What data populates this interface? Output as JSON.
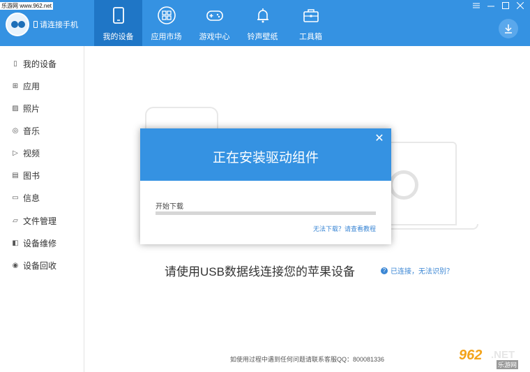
{
  "watermark": "乐游网 www.962.net",
  "header": {
    "connect_label": "请连接手机",
    "nav": [
      {
        "label": "我的设备",
        "icon": "tablet-icon",
        "active": true
      },
      {
        "label": "应用市场",
        "icon": "apps-grid-icon",
        "active": false
      },
      {
        "label": "游戏中心",
        "icon": "gamepad-icon",
        "active": false
      },
      {
        "label": "铃声壁纸",
        "icon": "bell-icon",
        "active": false
      },
      {
        "label": "工具箱",
        "icon": "toolbox-icon",
        "active": false
      }
    ],
    "window_controls": [
      "menu-icon",
      "minimize-icon",
      "maximize-icon",
      "close-icon"
    ],
    "download_icon": "download-icon",
    "accent": "#3592e2"
  },
  "sidebar": {
    "items": [
      {
        "label": "我的设备",
        "icon": "device-icon"
      },
      {
        "label": "应用",
        "icon": "apps-icon"
      },
      {
        "label": "照片",
        "icon": "photo-icon"
      },
      {
        "label": "音乐",
        "icon": "music-icon"
      },
      {
        "label": "视频",
        "icon": "video-icon"
      },
      {
        "label": "图书",
        "icon": "book-icon"
      },
      {
        "label": "信息",
        "icon": "message-icon"
      },
      {
        "label": "文件管理",
        "icon": "folder-icon"
      },
      {
        "label": "设备维修",
        "icon": "repair-icon"
      },
      {
        "label": "设备回收",
        "icon": "recycle-icon"
      }
    ]
  },
  "main": {
    "usb_message": "请使用USB数据线连接您的苹果设备",
    "connected_help": "已连接，无法识别？",
    "footer_note": "如使用过程中遇到任何问题请联系客服QQ：800081336"
  },
  "brand_mark": {
    "logo": "962",
    "text": ".NET",
    "sub": "乐游网"
  },
  "modal": {
    "title": "正在安装驱动组件",
    "progress_label": "开始下载",
    "progress_value": 0,
    "help_link": "无法下载？请查看教程"
  }
}
